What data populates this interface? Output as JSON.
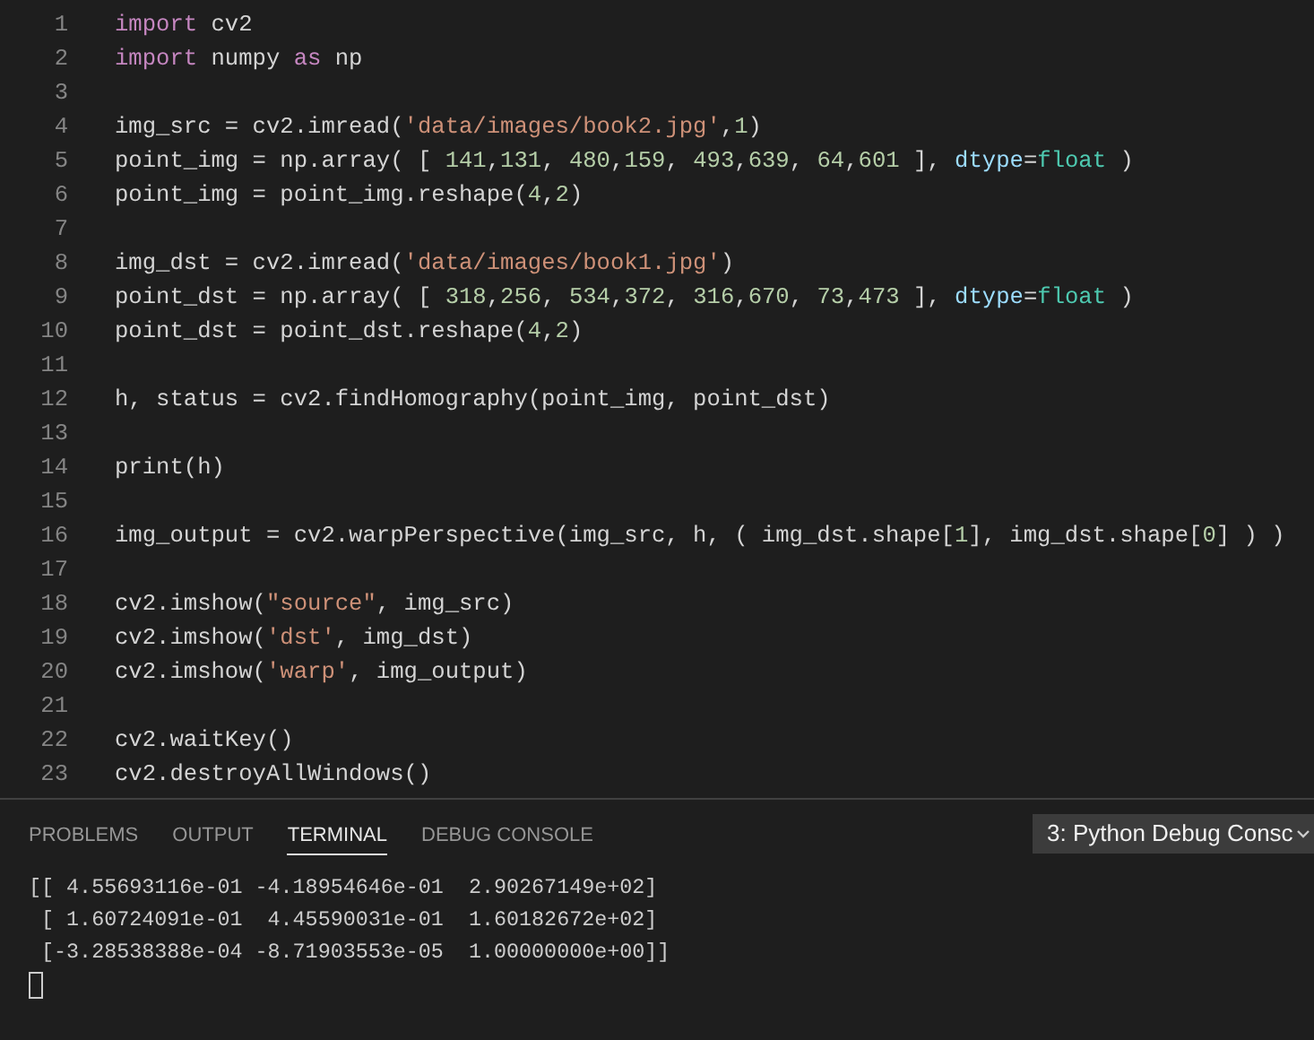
{
  "editor": {
    "lines": [
      {
        "number": "1",
        "tokens": [
          {
            "kind": "keyword",
            "text": "import"
          },
          {
            "kind": "plain",
            "text": " cv2"
          }
        ]
      },
      {
        "number": "2",
        "tokens": [
          {
            "kind": "keyword",
            "text": "import"
          },
          {
            "kind": "plain",
            "text": " numpy "
          },
          {
            "kind": "keyword",
            "text": "as"
          },
          {
            "kind": "plain",
            "text": " np"
          }
        ]
      },
      {
        "number": "3"
      },
      {
        "number": "4",
        "tokens": [
          {
            "kind": "plain",
            "text": "img_src = cv2.imread("
          },
          {
            "kind": "string",
            "text": "'data/images/book2.jpg'"
          },
          {
            "kind": "plain",
            "text": ","
          },
          {
            "kind": "number",
            "text": "1"
          },
          {
            "kind": "plain",
            "text": ")"
          }
        ]
      },
      {
        "number": "5",
        "tokens": [
          {
            "kind": "plain",
            "text": "point_img = np.array( [ "
          },
          {
            "kind": "number",
            "text": "141"
          },
          {
            "kind": "plain",
            "text": ","
          },
          {
            "kind": "number",
            "text": "131"
          },
          {
            "kind": "plain",
            "text": ", "
          },
          {
            "kind": "number",
            "text": "480"
          },
          {
            "kind": "plain",
            "text": ","
          },
          {
            "kind": "number",
            "text": "159"
          },
          {
            "kind": "plain",
            "text": ", "
          },
          {
            "kind": "number",
            "text": "493"
          },
          {
            "kind": "plain",
            "text": ","
          },
          {
            "kind": "number",
            "text": "639"
          },
          {
            "kind": "plain",
            "text": ", "
          },
          {
            "kind": "number",
            "text": "64"
          },
          {
            "kind": "plain",
            "text": ","
          },
          {
            "kind": "number",
            "text": "601"
          },
          {
            "kind": "plain",
            "text": " ], "
          },
          {
            "kind": "param",
            "text": "dtype"
          },
          {
            "kind": "plain",
            "text": "="
          },
          {
            "kind": "type",
            "text": "float"
          },
          {
            "kind": "plain",
            "text": " )"
          }
        ]
      },
      {
        "number": "6",
        "tokens": [
          {
            "kind": "plain",
            "text": "point_img = point_img.reshape("
          },
          {
            "kind": "number",
            "text": "4"
          },
          {
            "kind": "plain",
            "text": ","
          },
          {
            "kind": "number",
            "text": "2"
          },
          {
            "kind": "plain",
            "text": ")"
          }
        ]
      },
      {
        "number": "7"
      },
      {
        "number": "8",
        "tokens": [
          {
            "kind": "plain",
            "text": "img_dst = cv2.imread("
          },
          {
            "kind": "string",
            "text": "'data/images/book1.jpg'"
          },
          {
            "kind": "plain",
            "text": ")"
          }
        ]
      },
      {
        "number": "9",
        "tokens": [
          {
            "kind": "plain",
            "text": "point_dst = np.array( [ "
          },
          {
            "kind": "number",
            "text": "318"
          },
          {
            "kind": "plain",
            "text": ","
          },
          {
            "kind": "number",
            "text": "256"
          },
          {
            "kind": "plain",
            "text": ", "
          },
          {
            "kind": "number",
            "text": "534"
          },
          {
            "kind": "plain",
            "text": ","
          },
          {
            "kind": "number",
            "text": "372"
          },
          {
            "kind": "plain",
            "text": ", "
          },
          {
            "kind": "number",
            "text": "316"
          },
          {
            "kind": "plain",
            "text": ","
          },
          {
            "kind": "number",
            "text": "670"
          },
          {
            "kind": "plain",
            "text": ", "
          },
          {
            "kind": "number",
            "text": "73"
          },
          {
            "kind": "plain",
            "text": ","
          },
          {
            "kind": "number",
            "text": "473"
          },
          {
            "kind": "plain",
            "text": " ], "
          },
          {
            "kind": "param",
            "text": "dtype"
          },
          {
            "kind": "plain",
            "text": "="
          },
          {
            "kind": "type",
            "text": "float"
          },
          {
            "kind": "plain",
            "text": " )"
          }
        ]
      },
      {
        "number": "10",
        "tokens": [
          {
            "kind": "plain",
            "text": "point_dst = point_dst.reshape("
          },
          {
            "kind": "number",
            "text": "4"
          },
          {
            "kind": "plain",
            "text": ","
          },
          {
            "kind": "number",
            "text": "2"
          },
          {
            "kind": "plain",
            "text": ")"
          }
        ]
      },
      {
        "number": "11"
      },
      {
        "number": "12",
        "tokens": [
          {
            "kind": "plain",
            "text": "h, status = cv2.findHomography(point_img, point_dst)"
          }
        ]
      },
      {
        "number": "13"
      },
      {
        "number": "14",
        "tokens": [
          {
            "kind": "plain",
            "text": "print(h)"
          }
        ]
      },
      {
        "number": "15"
      },
      {
        "number": "16",
        "tokens": [
          {
            "kind": "plain",
            "text": "img_output = cv2.warpPerspective(img_src, h, ( img_dst.shape["
          },
          {
            "kind": "number",
            "text": "1"
          },
          {
            "kind": "plain",
            "text": "], img_dst.shape["
          },
          {
            "kind": "number",
            "text": "0"
          },
          {
            "kind": "plain",
            "text": "] ) )"
          }
        ]
      },
      {
        "number": "17"
      },
      {
        "number": "18",
        "tokens": [
          {
            "kind": "plain",
            "text": "cv2.imshow("
          },
          {
            "kind": "string",
            "text": "\"source\""
          },
          {
            "kind": "plain",
            "text": ", img_src)"
          }
        ]
      },
      {
        "number": "19",
        "tokens": [
          {
            "kind": "plain",
            "text": "cv2.imshow("
          },
          {
            "kind": "string",
            "text": "'dst'"
          },
          {
            "kind": "plain",
            "text": ", img_dst)"
          }
        ]
      },
      {
        "number": "20",
        "tokens": [
          {
            "kind": "plain",
            "text": "cv2.imshow("
          },
          {
            "kind": "string",
            "text": "'warp'"
          },
          {
            "kind": "plain",
            "text": ", img_output)"
          }
        ]
      },
      {
        "number": "21"
      },
      {
        "number": "22",
        "tokens": [
          {
            "kind": "plain",
            "text": "cv2.waitKey()"
          }
        ]
      },
      {
        "number": "23",
        "tokens": [
          {
            "kind": "plain",
            "text": "cv2.destroyAllWindows()"
          }
        ]
      }
    ]
  },
  "panel": {
    "tabs": [
      {
        "label": "PROBLEMS",
        "selected": false
      },
      {
        "label": "OUTPUT",
        "selected": false
      },
      {
        "label": "TERMINAL",
        "selected": true
      },
      {
        "label": "DEBUG CONSOLE",
        "selected": false
      }
    ],
    "terminal_selector": "3: Python Debug Consc",
    "terminal_lines": [
      "[[ 4.55693116e-01 -4.18954646e-01  2.90267149e+02]",
      " [ 1.60724091e-01  4.45590031e-01  1.60182672e+02]",
      " [-3.28538388e-04 -8.71903553e-05  1.00000000e+00]]"
    ]
  }
}
